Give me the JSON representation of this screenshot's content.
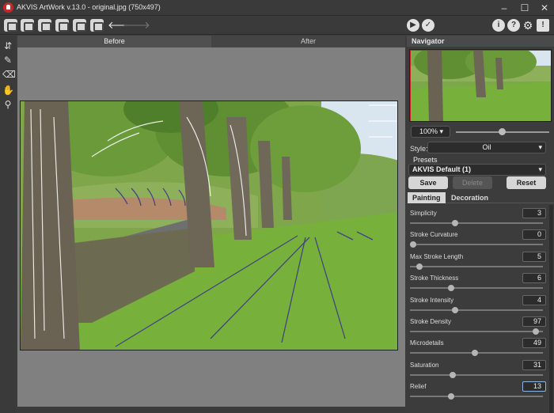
{
  "window": {
    "title": "AKVIS ArtWork v.13.0 - original.jpg (750x497)"
  },
  "canvas": {
    "tabs": [
      "Before",
      "After"
    ]
  },
  "navigator": {
    "title": "Navigator",
    "zoom": "100%"
  },
  "settings": {
    "style_label": "Style:",
    "style_value": "Oil",
    "presets_label": "Presets",
    "preset_value": "AKVIS Default (1)",
    "save_label": "Save",
    "delete_label": "Delete",
    "reset_label": "Reset",
    "tabs": [
      "Painting",
      "Decoration"
    ],
    "params": [
      {
        "label": "Simplicity",
        "value": "3",
        "level": 0.33
      },
      {
        "label": "Stroke Curvature",
        "value": "0",
        "level": 0.0
      },
      {
        "label": "Max Stroke Length",
        "value": "5",
        "level": 0.05
      },
      {
        "label": "Stroke Thickness",
        "value": "6",
        "level": 0.3
      },
      {
        "label": "Stroke Intensity",
        "value": "4",
        "level": 0.33
      },
      {
        "label": "Stroke Density",
        "value": "97",
        "level": 0.97
      },
      {
        "label": "Microdetails",
        "value": "49",
        "level": 0.49
      },
      {
        "label": "Saturation",
        "value": "31",
        "level": 0.31
      },
      {
        "label": "Relief",
        "value": "13",
        "level": 0.3
      }
    ]
  },
  "icons": {
    "toolbar": [
      "open-icon",
      "save-icon",
      "print-icon",
      "share-icon",
      "brush-icon",
      "settings-icon",
      "undo-icon",
      "redo-icon",
      "run-icon",
      "apply-icon",
      "info-icon",
      "help-icon",
      "preferences-icon",
      "alert-icon"
    ],
    "tools": [
      "direction-tool-icon",
      "stroke-brush-icon",
      "eraser-icon",
      "hand-icon",
      "zoom-icon"
    ]
  }
}
